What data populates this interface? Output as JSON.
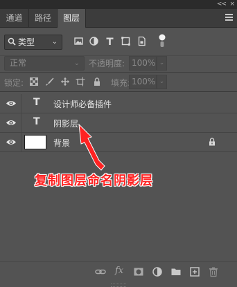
{
  "panel": {
    "collapse_glyph": "<<",
    "close_glyph": "×",
    "tabs": [
      {
        "label": "通道"
      },
      {
        "label": "路径"
      },
      {
        "label": "图层"
      }
    ]
  },
  "filter": {
    "kind_label": "类型",
    "icons": [
      "pixel-filter-icon",
      "adjustment-filter-icon",
      "type-filter-icon",
      "shape-filter-icon",
      "smart-object-filter-icon",
      "filter-toggle-icon"
    ]
  },
  "blend": {
    "mode_value": "正常",
    "opacity_label": "不透明度:",
    "opacity_value": "100%"
  },
  "lock": {
    "label": "锁定:",
    "fill_label": "填充:",
    "fill_value": "100%"
  },
  "layers": [
    {
      "name": "设计师必备插件",
      "type": "text",
      "visible": true
    },
    {
      "name": "阴影层",
      "type": "text",
      "visible": true
    },
    {
      "name": "背景",
      "type": "image",
      "visible": true,
      "locked": true
    }
  ],
  "annotation": {
    "text": "复制图层命名阴影层",
    "color": "#ff2222"
  },
  "colors": {
    "panel_bg": "#535353",
    "tab_bar_bg": "#3c3c3c",
    "annotation_red": "#ff2222"
  },
  "bottom_icons": [
    "link-layers-icon",
    "fx-icon",
    "add-mask-icon",
    "new-adjustment-icon",
    "new-group-icon",
    "new-layer-icon",
    "delete-layer-icon"
  ]
}
